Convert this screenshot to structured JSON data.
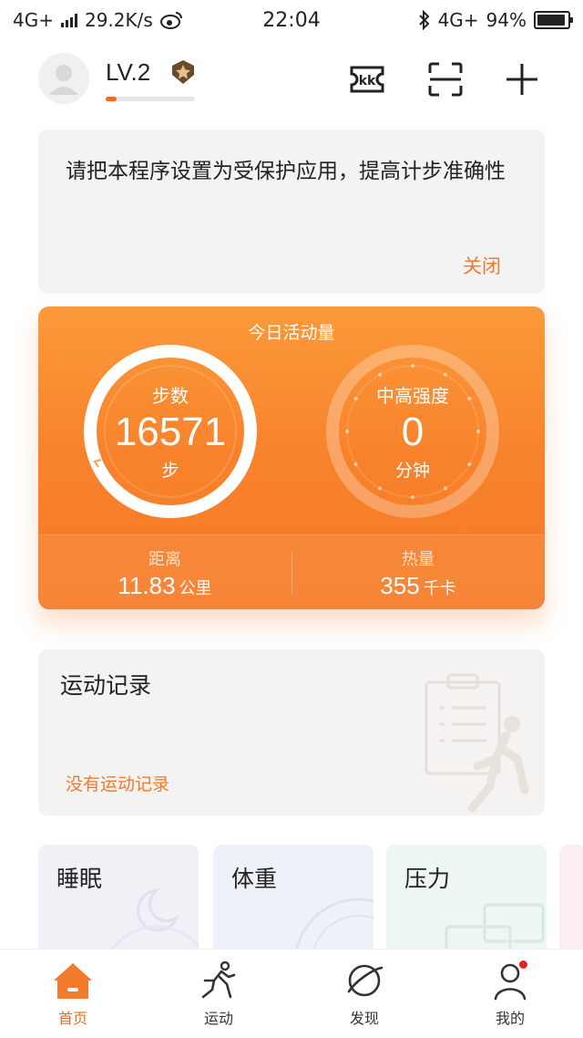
{
  "status_bar": {
    "network": "4G+",
    "speed": "29.2K/s",
    "time": "22:04",
    "network_right": "4G+",
    "battery": "94%",
    "battery_level": 0.94
  },
  "header": {
    "level": "LV.2",
    "level_progress": 0.12,
    "icons": [
      "kk-icon",
      "scan-icon",
      "plus-icon"
    ]
  },
  "notice": {
    "text": "请把本程序设置为受保护应用，提高计步准确性",
    "close_label": "关闭"
  },
  "activity": {
    "title": "今日活动量",
    "steps": {
      "label": "步数",
      "value": "16571",
      "unit": "步"
    },
    "intensity": {
      "label": "中高强度",
      "value": "0",
      "unit": "分钟"
    },
    "distance": {
      "label": "距离",
      "value": "11.83",
      "unit": "公里"
    },
    "calories": {
      "label": "热量",
      "value": "355",
      "unit": "千卡"
    }
  },
  "records": {
    "title": "运动记录",
    "empty_text": "没有运动记录"
  },
  "cards": {
    "sleep": "睡眠",
    "weight": "体重",
    "stress": "压力"
  },
  "nav": {
    "home": "首页",
    "sport": "运动",
    "discover": "发现",
    "mine": "我的"
  },
  "colors": {
    "accent": "#f26a21",
    "card_orange_top": "#fb9a3a",
    "card_orange_bottom": "#f57a27",
    "notice_bg": "#f3f3f3",
    "badge_red": "#e52222"
  }
}
